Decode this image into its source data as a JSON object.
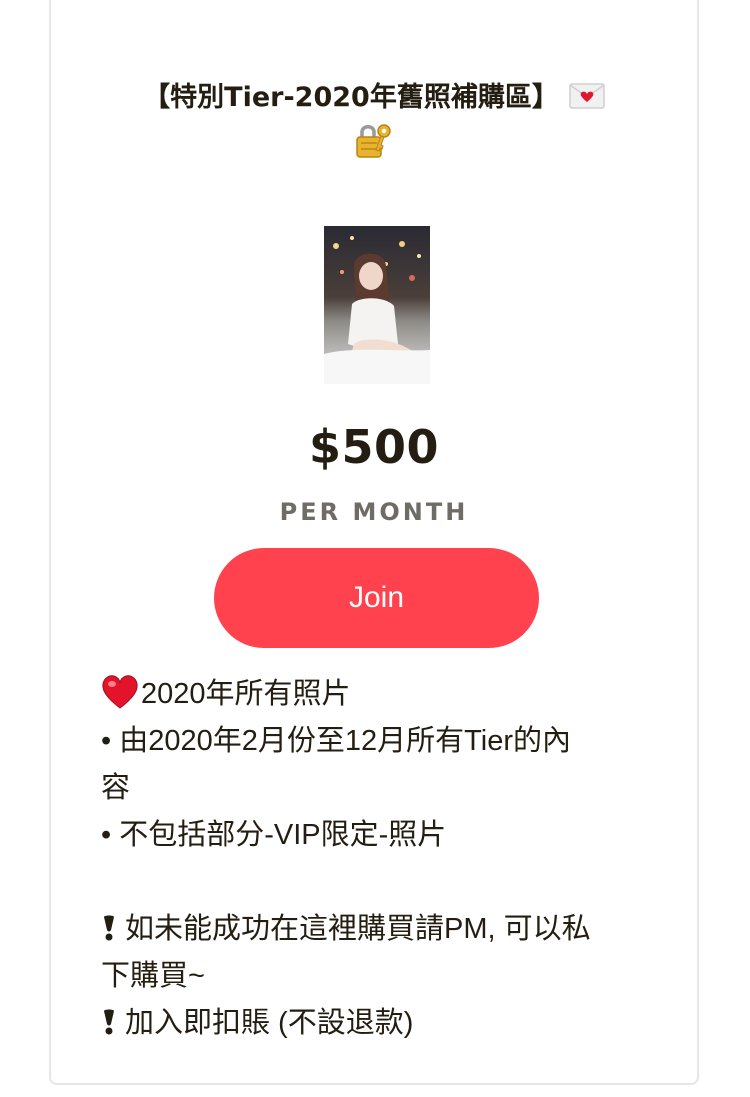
{
  "tier": {
    "title": "【特別Tier-2020年舊照補購區】",
    "title_icons": [
      "envelope-heart-icon",
      "lock-key-icon"
    ],
    "image_alt": "tier-preview-photo",
    "price": "$500",
    "period": "PER MONTH",
    "join_label": "Join",
    "accent_color": "#ff424d",
    "description": {
      "line1": "2020年所有照片",
      "line2": "• 由2020年2月份至12月所有Tier的內",
      "line3": "容",
      "line4": "• 不包括部分-VIP限定-照片",
      "line5": "如未能成功在這裡購買請PM, 可以私",
      "line6": "下購買~",
      "line7": "加入即扣賬 (不設退款)"
    }
  }
}
